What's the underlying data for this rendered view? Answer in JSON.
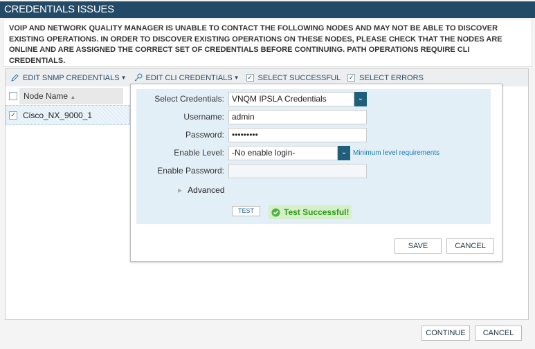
{
  "dialog": {
    "title": "CREDENTIALS ISSUES",
    "message": "VOIP AND NETWORK QUALITY MANAGER IS UNABLE TO CONTACT THE FOLLOWING NODES AND MAY NOT BE ABLE TO DISCOVER EXISTING OPERATIONS. IN ORDER TO DISCOVER EXISTING OPERATIONS ON THESE NODES, PLEASE CHECK THAT THE NODES ARE ONLINE AND ARE ASSIGNED THE CORRECT SET OF CREDENTIALS BEFORE CONTINUING. PATH OPERATIONS REQUIRE CLI CREDENTIALS."
  },
  "toolbar": {
    "edit_snmp": "EDIT SNMP CREDENTIALS",
    "edit_cli": "EDIT CLI CREDENTIALS",
    "select_successful": "SELECT SUCCESSFUL",
    "select_errors": "SELECT ERRORS"
  },
  "grid": {
    "column": "Node Name",
    "sort": "▲",
    "rows": [
      {
        "name": "Cisco_NX_9000_1",
        "checked": true
      }
    ]
  },
  "form": {
    "select_label": "Select Credentials:",
    "select_value": "VNQM IPSLA Credentials",
    "username_label": "Username:",
    "username": "admin",
    "password_label": "Password:",
    "password": "•••••••••",
    "enable_label": "Enable Level:",
    "enable_value": "-No enable login-",
    "min_link": "Minimum level requirements",
    "enable_pw_label": "Enable Password:",
    "advanced": "Advanced",
    "test": "TEST",
    "test_result": "Test Successful!",
    "save": "SAVE",
    "cancel": "CANCEL"
  },
  "footer": {
    "continue": "CONTINUE",
    "cancel": "CANCEL"
  }
}
